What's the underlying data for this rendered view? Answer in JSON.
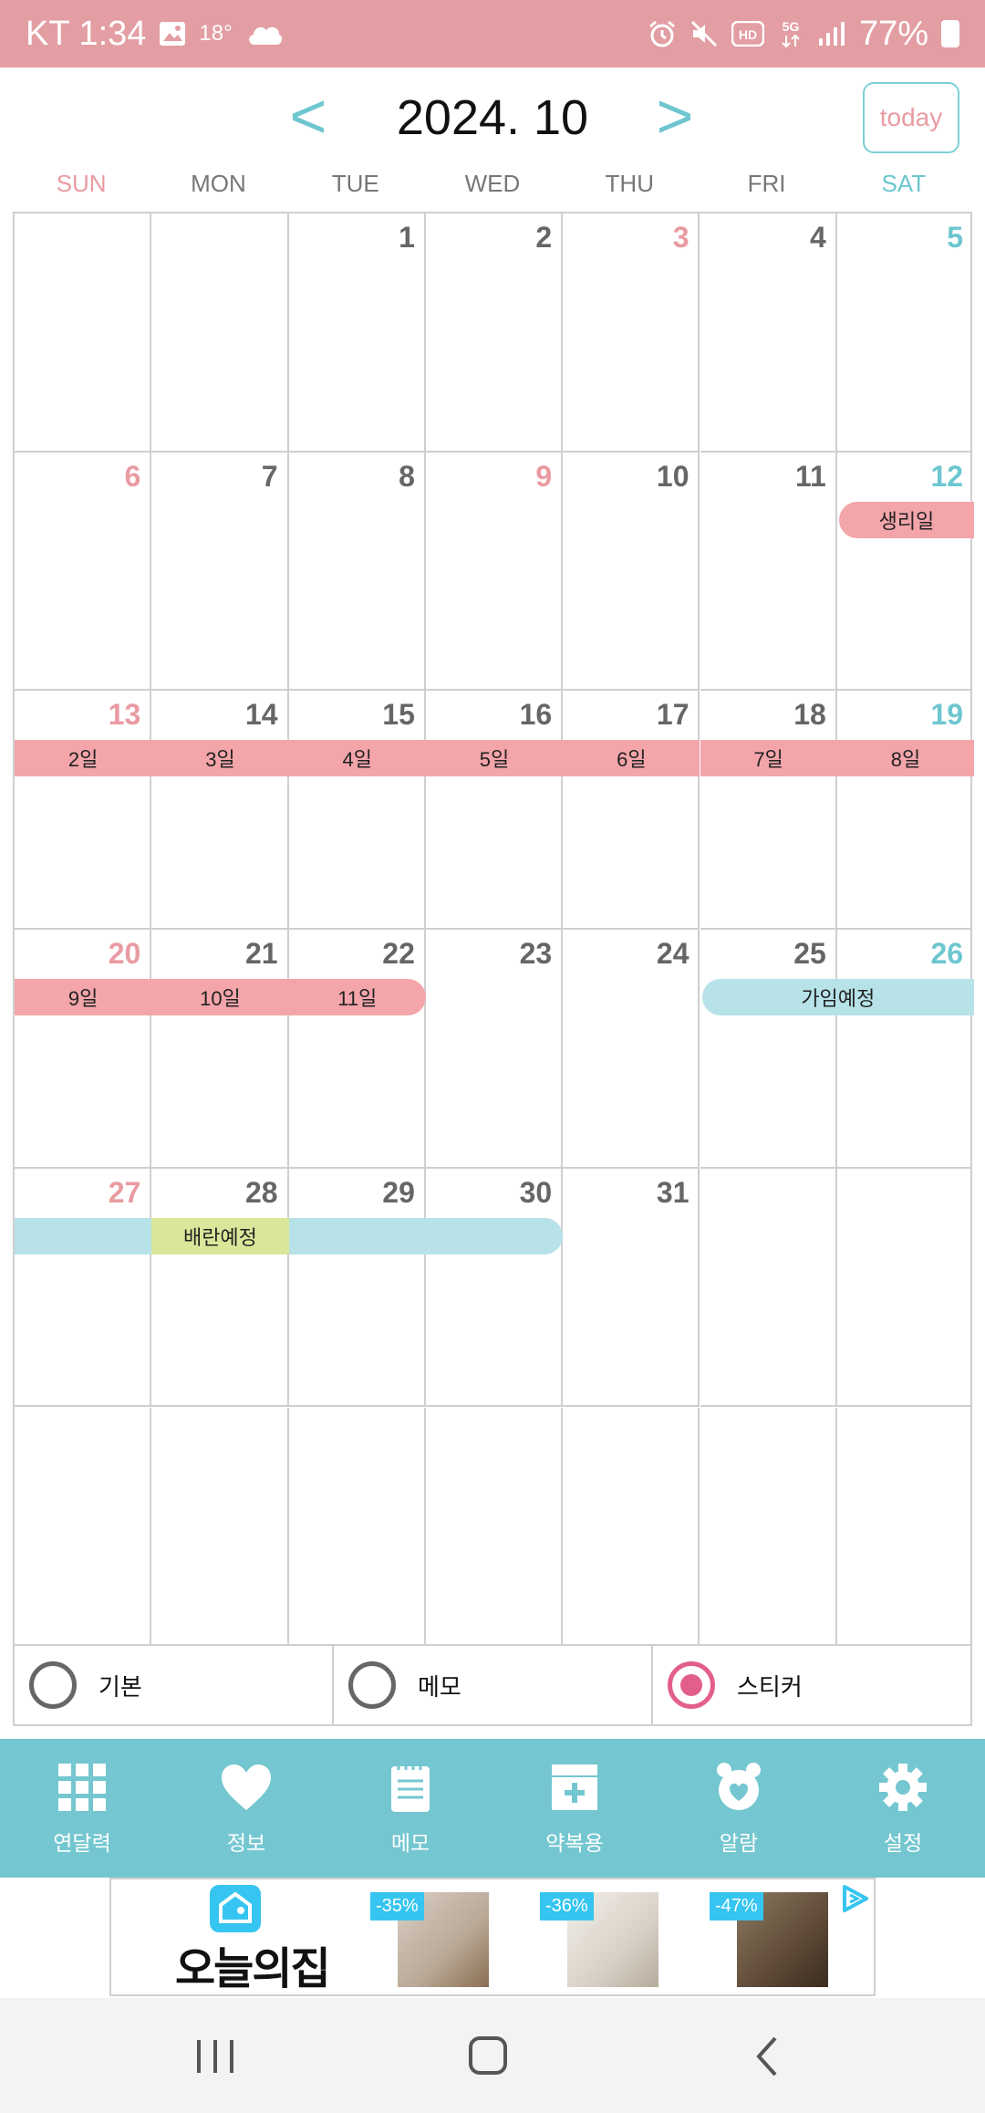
{
  "status_bar": {
    "carrier_time": "KT 1:34",
    "temperature": "18°",
    "battery": "77%",
    "icons": [
      "image-icon",
      "cloud-icon",
      "alarm-icon",
      "mute-icon",
      "hd-icon",
      "5g-icon",
      "signal-icon",
      "battery-icon"
    ]
  },
  "header": {
    "month_title": "2024. 10",
    "prev_label": "<",
    "next_label": ">",
    "today_label": "today"
  },
  "weekdays": [
    "SUN",
    "MON",
    "TUE",
    "WED",
    "THU",
    "FRI",
    "SAT"
  ],
  "calendar": {
    "weeks": [
      [
        "",
        "",
        "1",
        "2",
        "3",
        "4",
        "5"
      ],
      [
        "6",
        "7",
        "8",
        "9",
        "10",
        "11",
        "12"
      ],
      [
        "13",
        "14",
        "15",
        "16",
        "17",
        "18",
        "19"
      ],
      [
        "20",
        "21",
        "22",
        "23",
        "24",
        "25",
        "26"
      ],
      [
        "27",
        "28",
        "29",
        "30",
        "31",
        "",
        ""
      ],
      [
        "",
        "",
        "",
        "",
        "",
        "",
        ""
      ]
    ],
    "events": {
      "period_start": "생리일",
      "period_days": [
        "2일",
        "3일",
        "4일",
        "5일",
        "6일",
        "7일",
        "8일",
        "9일",
        "10일",
        "11일"
      ],
      "fertile_label": "가임예정",
      "ovulation_label": "배란예정"
    },
    "colors": {
      "period": "#f3a5aa",
      "fertile": "#b6e2e8",
      "ovulation": "#d9e79a",
      "sunday": "#e99ba2",
      "saturday": "#6dc6d0"
    }
  },
  "modes": [
    {
      "label": "기본",
      "selected": false
    },
    {
      "label": "메모",
      "selected": false
    },
    {
      "label": "스티커",
      "selected": true
    }
  ],
  "bottom_nav": [
    {
      "label": "연달력",
      "icon": "grid-icon"
    },
    {
      "label": "정보",
      "icon": "heart-icon"
    },
    {
      "label": "메모",
      "icon": "notepad-icon"
    },
    {
      "label": "약복용",
      "icon": "medicine-icon"
    },
    {
      "label": "알람",
      "icon": "alarm-clock-icon"
    },
    {
      "label": "설정",
      "icon": "gear-icon"
    }
  ],
  "ad": {
    "brand": "오늘의집",
    "badges": [
      "-35%",
      "-36%",
      "-47%"
    ]
  },
  "theme": {
    "accent_pink": "#e39ea3",
    "accent_teal": "#74c7d0"
  }
}
